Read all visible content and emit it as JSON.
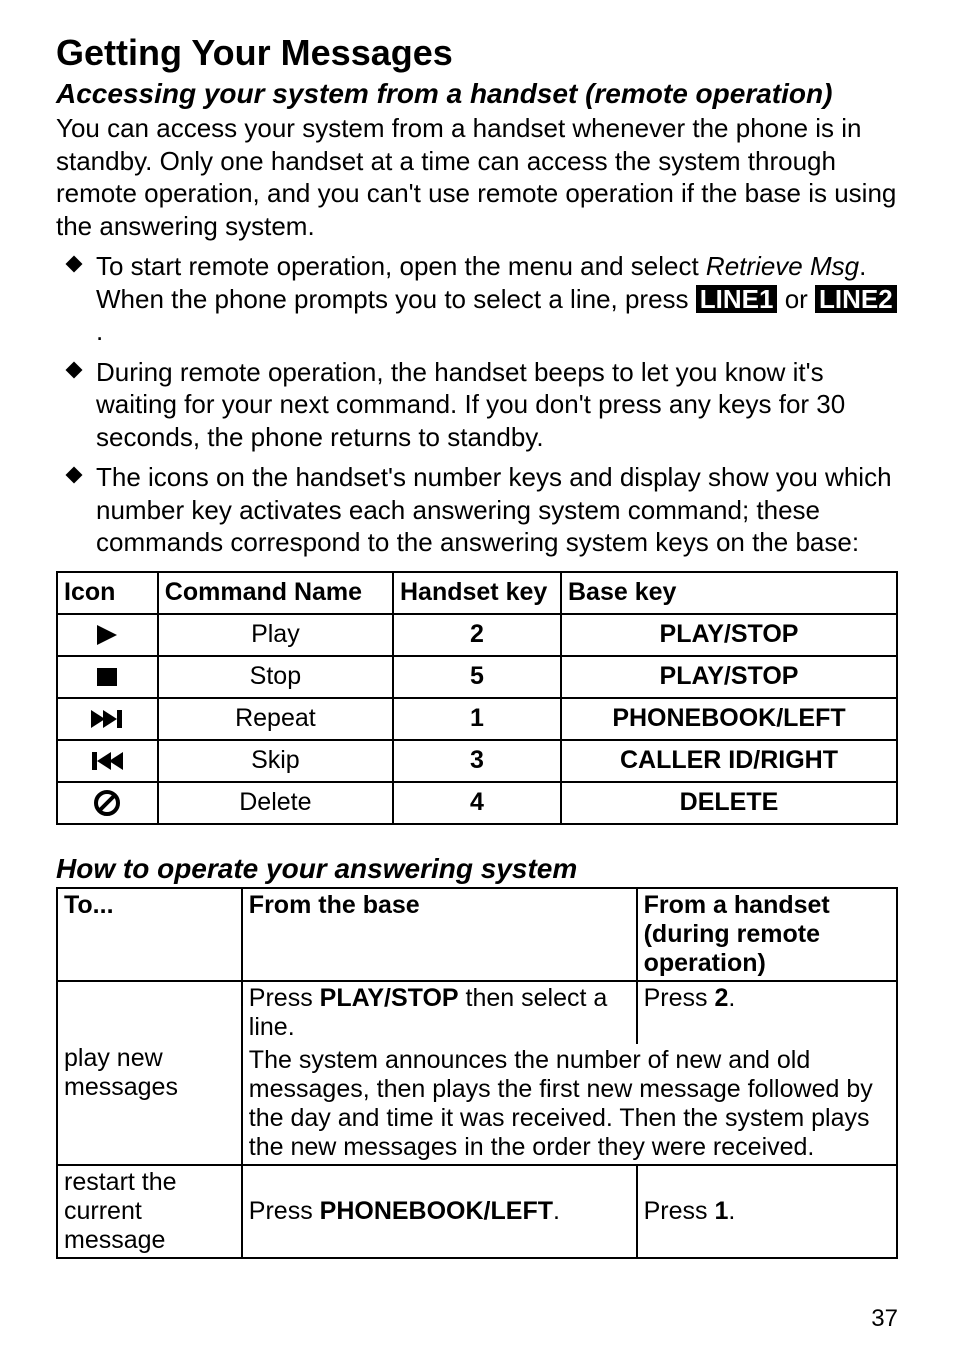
{
  "page_number": "37",
  "heading": "Getting Your Messages",
  "section1": {
    "title": "Accessing your system from a handset (remote operation)",
    "intro": "You can access your system from a handset whenever the phone is in standby. Only one handset at a time can access the system through remote operation, and you can't use remote operation if the base is using the answering system.",
    "bullets": {
      "b1_pre": "To start remote operation, open the menu and select ",
      "b1_italic": "Retrieve Msg",
      "b1_mid": ". When the phone prompts you to select a line, press ",
      "b1_label1": "LINE1",
      "b1_or": " or ",
      "b1_label2": "LINE2",
      "b1_end": ".",
      "b2": "During remote operation, the handset beeps to let you know it's waiting for your next command. If you don't press any keys for 30 seconds, the phone returns to standby.",
      "b3": "The icons on the handset's number keys and display show you which number key activates each answering system command; these commands correspond to the answering system keys on the base:"
    }
  },
  "table1": {
    "headers": {
      "icon": "Icon",
      "cmd": "Command Name",
      "hkey": "Handset key",
      "bkey": "Base key"
    },
    "rows": [
      {
        "icon": "play",
        "cmd": "Play",
        "hkey": "2",
        "bkey": "PLAY/STOP"
      },
      {
        "icon": "stop",
        "cmd": "Stop",
        "hkey": "5",
        "bkey": "PLAY/STOP"
      },
      {
        "icon": "skipfwd",
        "cmd": "Repeat",
        "hkey": "1",
        "bkey": "PHONEBOOK/LEFT"
      },
      {
        "icon": "skipback",
        "cmd": "Skip",
        "hkey": "3",
        "bkey": "CALLER ID/RIGHT"
      },
      {
        "icon": "nocircle",
        "cmd": "Delete",
        "hkey": "4",
        "bkey": "DELETE"
      }
    ]
  },
  "section2": {
    "title": "How to operate your answering system"
  },
  "table2": {
    "headers": {
      "to": "To...",
      "base": "From the base",
      "handset": "From a handset (during remote operation)"
    },
    "row1": {
      "to": "play new messages",
      "base_pre": "Press ",
      "base_bold": "PLAY/STOP",
      "base_post": " then select a line.",
      "handset_pre": "Press ",
      "handset_bold": "2",
      "handset_post": ".",
      "shared": "The system announces the number of new and old messages, then plays the first new message followed by the day and time it was received. Then the system plays the new messages in the order they were received."
    },
    "row2": {
      "to": "restart the current message",
      "base_pre": "Press ",
      "base_bold": "PHONEBOOK/LEFT",
      "base_post": ".",
      "handset_pre": "Press ",
      "handset_bold": "1",
      "handset_post": "."
    }
  },
  "chart_data": [
    {
      "type": "table",
      "title": "Handset remote-operation commands",
      "columns": [
        "Icon",
        "Command Name",
        "Handset key",
        "Base key"
      ],
      "rows": [
        [
          "play",
          "Play",
          "2",
          "PLAY/STOP"
        ],
        [
          "stop",
          "Stop",
          "5",
          "PLAY/STOP"
        ],
        [
          "skip-forward",
          "Repeat",
          "1",
          "PHONEBOOK/LEFT"
        ],
        [
          "skip-back",
          "Skip",
          "3",
          "CALLER ID/RIGHT"
        ],
        [
          "no-circle",
          "Delete",
          "4",
          "DELETE"
        ]
      ]
    },
    {
      "type": "table",
      "title": "How to operate your answering system",
      "columns": [
        "To...",
        "From the base",
        "From a handset (during remote operation)"
      ],
      "rows": [
        [
          "play new messages",
          "Press PLAY/STOP then select a line. The system announces the number of new and old messages, then plays the first new message followed by the day and time it was received. Then the system plays the new messages in the order they were received.",
          "Press 2. The system announces the number of new and old messages, then plays the first new message followed by the day and time it was received. Then the system plays the new messages in the order they were received."
        ],
        [
          "restart the current message",
          "Press PHONEBOOK/LEFT.",
          "Press 1."
        ]
      ]
    }
  ]
}
